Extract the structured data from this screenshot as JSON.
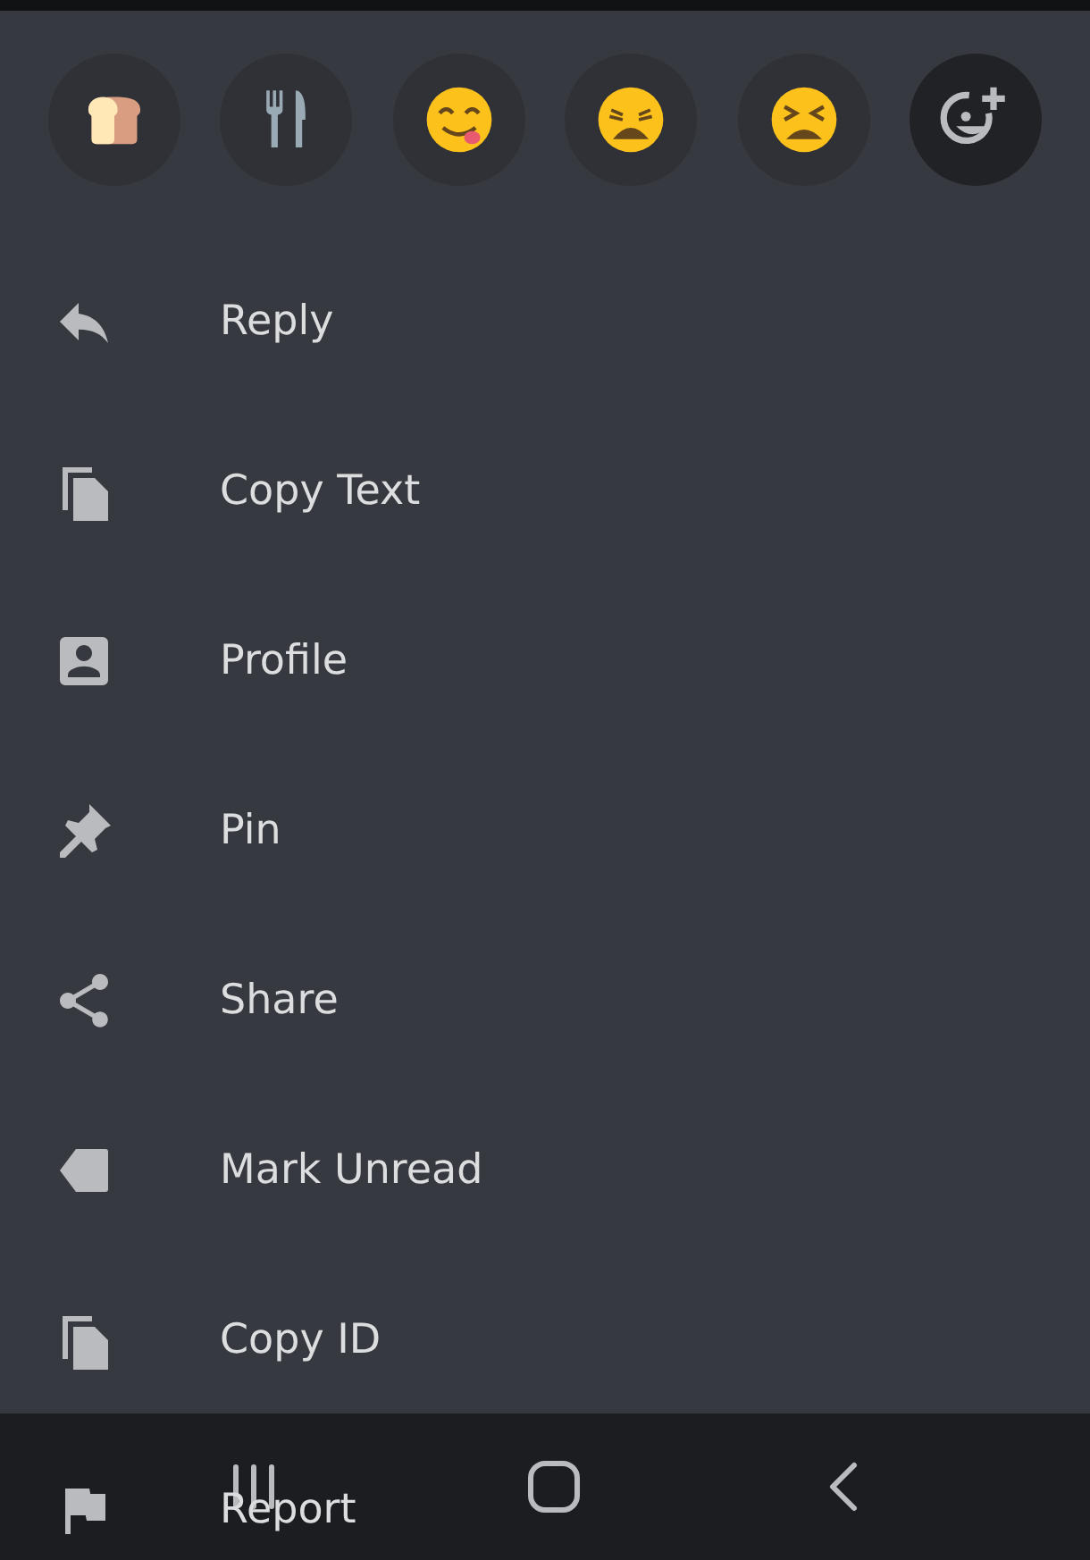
{
  "reactions": [
    {
      "kind": "bread"
    },
    {
      "kind": "utensils"
    },
    {
      "kind": "yum"
    },
    {
      "kind": "weary"
    },
    {
      "kind": "tired"
    },
    {
      "kind": "add"
    }
  ],
  "menu_items": [
    {
      "label": "Reply"
    },
    {
      "label": "Copy Text"
    },
    {
      "label": "Profile"
    },
    {
      "label": "Pin"
    },
    {
      "label": "Share"
    },
    {
      "label": "Mark Unread"
    },
    {
      "label": "Copy ID"
    },
    {
      "label": "Report"
    }
  ]
}
